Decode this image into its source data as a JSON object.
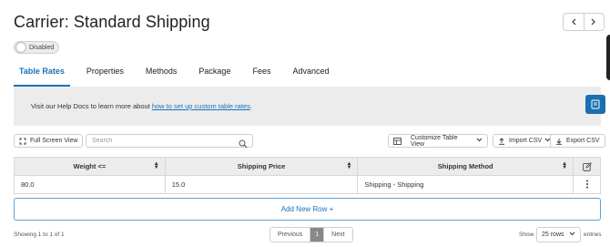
{
  "header": {
    "title": "Carrier: Standard Shipping"
  },
  "status_toggle": {
    "label": "Disabled"
  },
  "tabs": [
    {
      "label": "Table Rates",
      "active": true
    },
    {
      "label": "Properties",
      "active": false
    },
    {
      "label": "Methods",
      "active": false
    },
    {
      "label": "Package",
      "active": false
    },
    {
      "label": "Fees",
      "active": false
    },
    {
      "label": "Advanced",
      "active": false
    }
  ],
  "help": {
    "prefix": "Visit our Help Docs to learn more about ",
    "link_text": "how to set up custom table rates",
    "suffix": "."
  },
  "toolbar": {
    "full_screen_label": "Full Screen View",
    "search_placeholder": "Search",
    "customize_label": "Customize Table View",
    "import_label": "Import CSV",
    "export_label": "Export CSV"
  },
  "table": {
    "columns": [
      "Weight <=",
      "Shipping Price",
      "Shipping Method"
    ],
    "rows": [
      [
        "80.0",
        "15.0",
        "Shipping - Shipping"
      ]
    ]
  },
  "add_row_label": "Add New Row +",
  "footer": {
    "showing": "Showing 1 to 1 of 1",
    "previous": "Previous",
    "current_page": "1",
    "next": "Next",
    "show_label": "Show",
    "rows_value": "25 rows",
    "entries_label": "entries"
  },
  "icons": {
    "nav_prev": "chevron-left-icon",
    "nav_next": "chevron-right-icon",
    "side": "notes-icon",
    "full_screen": "expand-icon",
    "search": "search-icon",
    "customize": "table-icon",
    "import": "upload-icon",
    "export": "download-icon",
    "edit": "edit-icon",
    "row_menu": "kebab-menu-icon"
  },
  "colors": {
    "accent": "#1a72b8",
    "side_button": "#1a6fb0"
  }
}
